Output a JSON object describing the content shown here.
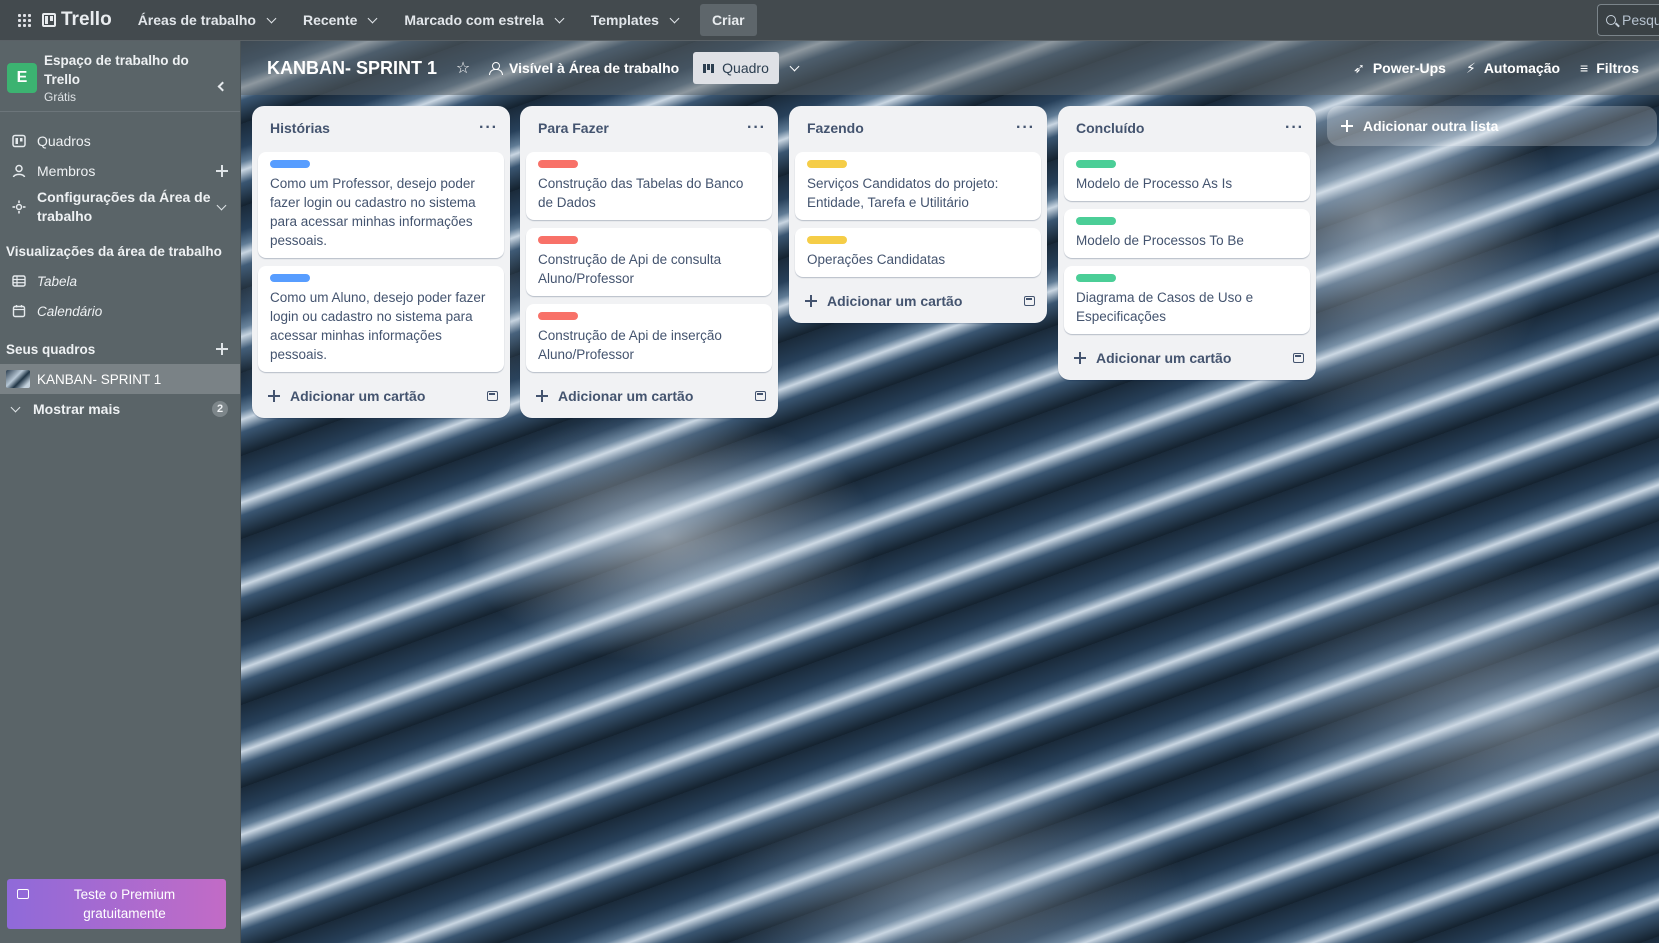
{
  "topbar": {
    "logo": "Trello",
    "nav": [
      {
        "label": "Áreas de trabalho"
      },
      {
        "label": "Recente"
      },
      {
        "label": "Marcado com estrela"
      },
      {
        "label": "Templates"
      }
    ],
    "create_label": "Criar",
    "search_placeholder": "Pesquisar"
  },
  "sidebar": {
    "workspace_initial": "E",
    "workspace_name": "Espaço de trabalho do Trello",
    "workspace_plan": "Grátis",
    "items": [
      {
        "label": "Quadros"
      },
      {
        "label": "Membros"
      },
      {
        "label": "Configurações da Área de trabalho"
      }
    ],
    "views_title": "Visualizações da área de trabalho",
    "views": [
      {
        "label": "Tabela"
      },
      {
        "label": "Calendário"
      }
    ],
    "boards_title": "Seus quadros",
    "boards": [
      {
        "label": "KANBAN- SPRINT 1"
      }
    ],
    "show_more_label": "Mostrar mais",
    "show_more_count": "2",
    "premium_label": "Teste o Premium gratuitamente"
  },
  "board": {
    "title": "KANBAN- SPRINT 1",
    "visibility_label": "Visível à Área de trabalho",
    "view_label": "Quadro",
    "powerups_label": "Power-Ups",
    "automation_label": "Automação",
    "filters_label": "Filtros",
    "add_list_label": "Adicionar outra lista",
    "add_card_label": "Adicionar um cartão",
    "lists": [
      {
        "title": "Histórias",
        "cards": [
          {
            "label_color": "#579dff",
            "text": "Como um Professor, desejo poder fazer login ou cadastro no sistema para acessar minhas informações pessoais."
          },
          {
            "label_color": "#579dff",
            "text": "Como um Aluno, desejo poder fazer login ou cadastro no sistema para acessar minhas informações pessoais."
          }
        ]
      },
      {
        "title": "Para Fazer",
        "cards": [
          {
            "label_color": "#f87168",
            "text": "Construção das Tabelas do Banco de Dados"
          },
          {
            "label_color": "#f87168",
            "text": "Construção de Api de consulta Aluno/Professor"
          },
          {
            "label_color": "#f87168",
            "text": "Construção de Api de inserção Aluno/Professor"
          }
        ]
      },
      {
        "title": "Fazendo",
        "cards": [
          {
            "label_color": "#f5cd47",
            "text": "Serviços Candidatos do projeto: Entidade, Tarefa e Utilitário"
          },
          {
            "label_color": "#f5cd47",
            "text": "Operações Candidatas"
          }
        ]
      },
      {
        "title": "Concluído",
        "cards": [
          {
            "label_color": "#4bce97",
            "text": "Modelo de Processo As Is"
          },
          {
            "label_color": "#4bce97",
            "text": "Modelo de Processos To Be"
          },
          {
            "label_color": "#4bce97",
            "text": "Diagrama de Casos de Uso e Especificações"
          }
        ]
      }
    ]
  }
}
